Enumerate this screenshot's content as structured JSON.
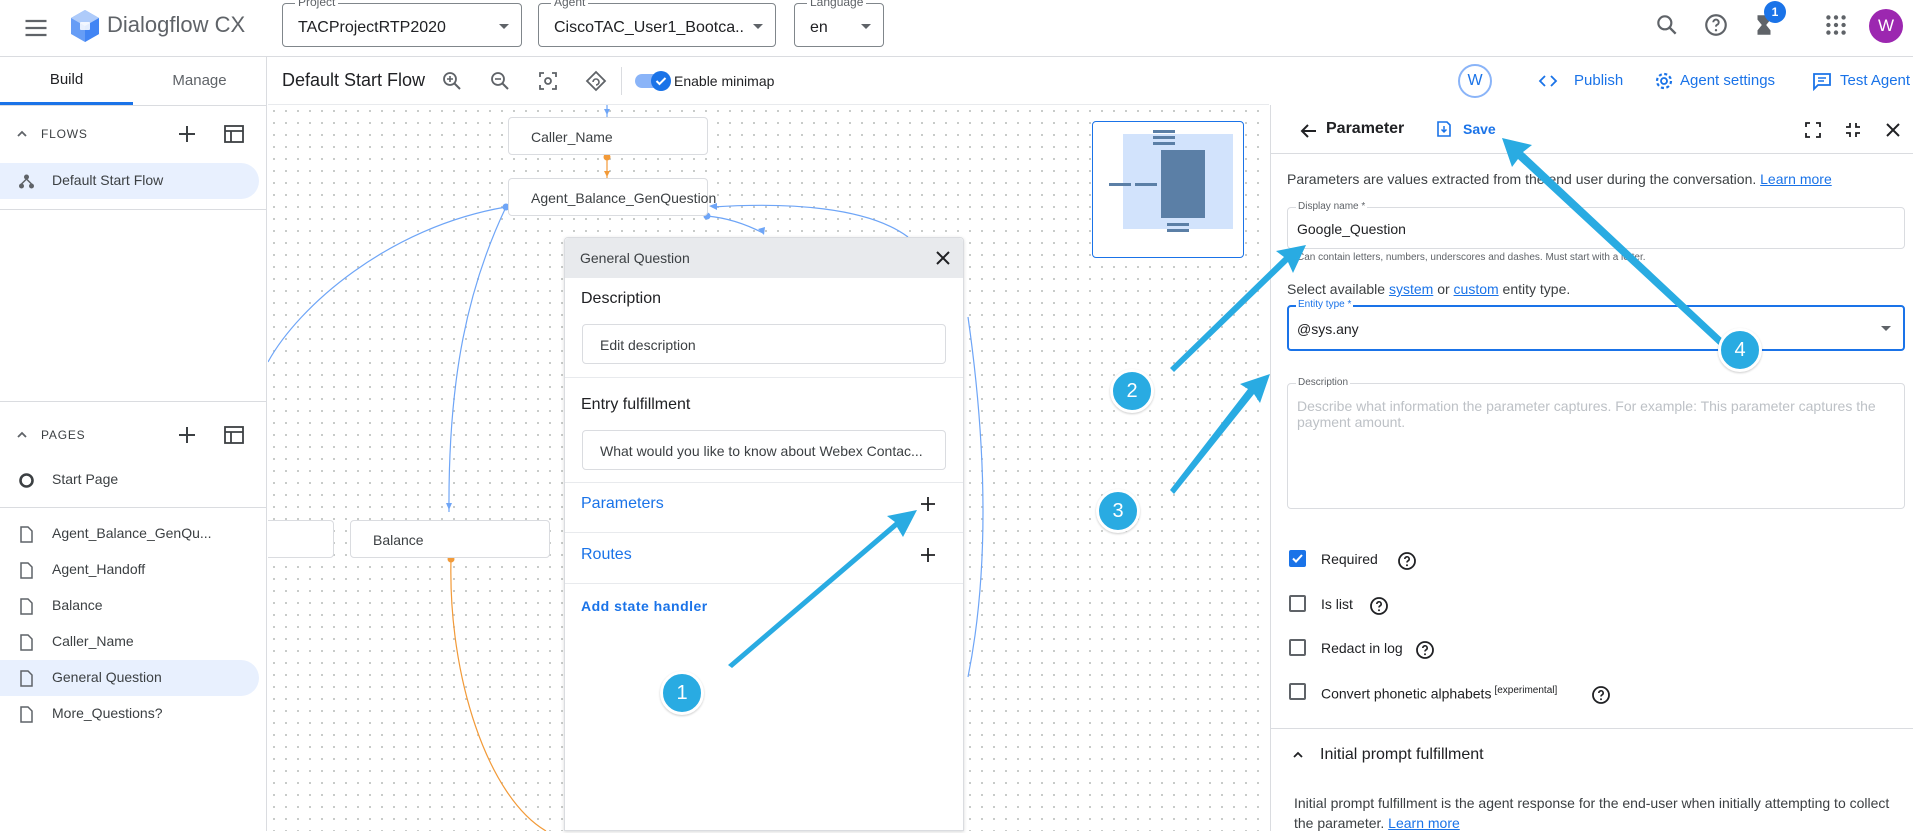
{
  "topbar": {
    "app_name": "Dialogflow CX",
    "project": {
      "label": "Project",
      "value": "TACProjectRTP2020"
    },
    "agent": {
      "label": "Agent",
      "value": "CiscoTAC_User1_Bootca..."
    },
    "language": {
      "label": "Language",
      "value": "en"
    },
    "notifications_count": "1",
    "user_initial": "W"
  },
  "left": {
    "tabs": [
      "Build",
      "Manage"
    ],
    "flows_title": "FLOWS",
    "flows": [
      "Default Start Flow"
    ],
    "pages_title": "PAGES",
    "start_page": "Start Page",
    "pages": [
      "Agent_Balance_GenQu...",
      "Agent_Handoff",
      "Balance",
      "Caller_Name",
      "General Question",
      "More_Questions?"
    ]
  },
  "canvas": {
    "flow_title": "Default Start Flow",
    "minimap_label": "Enable minimap",
    "nodes": [
      "Caller_Name",
      "Agent_Balance_GenQuestion",
      "Balance"
    ]
  },
  "header_actions": {
    "collab_initial": "W",
    "publish": "Publish",
    "agent_settings": "Agent settings",
    "test_agent": "Test Agent"
  },
  "general_question": {
    "title": "General Question",
    "description_label": "Description",
    "description_value": "Edit description",
    "entry_label": "Entry fulfillment",
    "entry_value": "What would you like to know about Webex Contac...",
    "parameters": "Parameters",
    "routes": "Routes",
    "add_state_handler": "Add state handler"
  },
  "parameter_panel": {
    "title": "Parameter",
    "save": "Save",
    "desc_prefix": "Parameters are values extracted from the end user during the conversation.",
    "learn_more": "Learn more",
    "display_name_label": "Display name *",
    "display_name_value": "Google_Question",
    "display_name_hint": "Can contain letters, numbers, underscores and dashes. Must start with a letter.",
    "select_prefix": "Select available",
    "system": "system",
    "or": "or",
    "custom": "custom",
    "select_suffix": "entity type.",
    "entity_type_label": "Entity type *",
    "entity_type_value": "@sys.any",
    "description_label": "Description",
    "description_placeholder": "Describe what information the parameter captures. For example: This parameter captures the payment amount.",
    "required": "Required",
    "is_list": "Is list",
    "redact": "Redact in log",
    "convert": "Convert phonetic alphabets",
    "experimental": "[experimental]",
    "initial_prompt_title": "Initial prompt fulfillment",
    "initial_prompt_desc": "Initial prompt fulfillment is the agent response for the end-user when initially attempting to collect the parameter.",
    "initial_prompt_learn_more": "Learn more"
  },
  "annotations": {
    "badges": [
      "1",
      "2",
      "3",
      "4"
    ]
  },
  "colors": {
    "accent": "#1a73e8",
    "callout": "#29abe2",
    "avatar": "#9c27b0",
    "route_orange": "#f29a38"
  }
}
